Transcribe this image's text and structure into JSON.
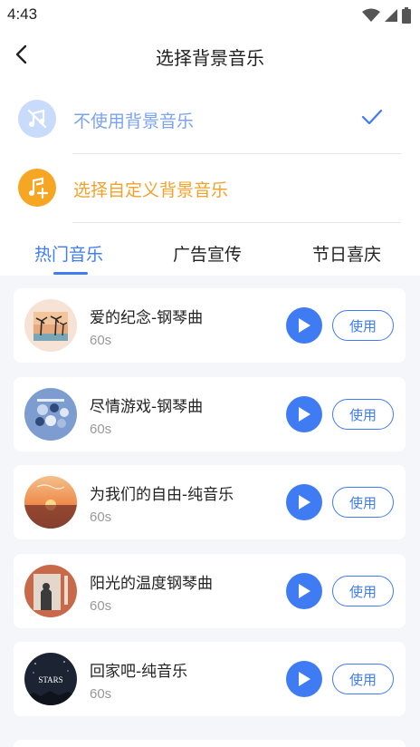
{
  "status_bar": {
    "time": "4:43"
  },
  "header": {
    "title": "选择背景音乐"
  },
  "options": {
    "none_label": "不使用背景音乐",
    "custom_label": "选择自定义背景音乐"
  },
  "tabs": [
    {
      "label": "热门音乐",
      "active": true
    },
    {
      "label": "广告宣传",
      "active": false
    },
    {
      "label": "节日喜庆",
      "active": false
    }
  ],
  "tracks": [
    {
      "name": "爱的纪念-钢琴曲",
      "duration": "60s",
      "use_label": "使用"
    },
    {
      "name": "尽情游戏-钢琴曲",
      "duration": "60s",
      "use_label": "使用"
    },
    {
      "name": "为我们的自由-纯音乐",
      "duration": "60s",
      "use_label": "使用"
    },
    {
      "name": "阳光的温度钢琴曲",
      "duration": "60s",
      "use_label": "使用"
    },
    {
      "name": "回家吧-纯音乐",
      "duration": "60s",
      "use_label": "使用"
    }
  ],
  "cover_text": {
    "stars": "STARS"
  },
  "colors": {
    "accent": "#3f7bf2",
    "orange": "#f5a623",
    "list_bg": "#f4f6fa"
  }
}
